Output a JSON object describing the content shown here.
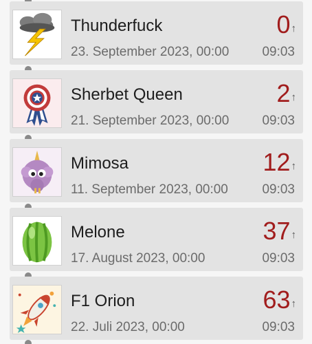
{
  "items": [
    {
      "name": "Thunderfuck",
      "date": "23. September 2023, 00:00",
      "count": "0",
      "time": "09:03",
      "icon": "thundercloud-icon"
    },
    {
      "name": "Sherbet Queen",
      "date": "21. September 2023, 00:00",
      "count": "2",
      "time": "09:03",
      "icon": "rosette-icon"
    },
    {
      "name": "Mimosa",
      "date": "11. September 2023, 00:00",
      "count": "12",
      "time": "09:03",
      "icon": "fluffy-monster-icon"
    },
    {
      "name": "Melone",
      "date": "17. August 2023, 00:00",
      "count": "37",
      "time": "09:03",
      "icon": "melon-egg-icon"
    },
    {
      "name": "F1 Orion",
      "date": "22. Juli 2023, 00:00",
      "count": "63",
      "time": "09:03",
      "icon": "rocket-icon"
    }
  ],
  "arrow_glyph": "↑",
  "colors": {
    "count": "#a11d1d",
    "card": "#e3e3e3",
    "connector": "#8a8a8a"
  }
}
